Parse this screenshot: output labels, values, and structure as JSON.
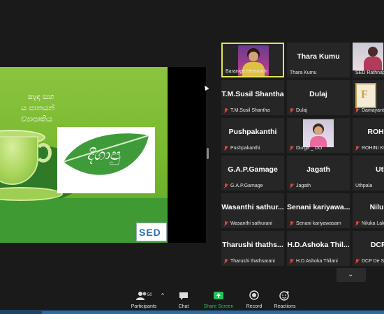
{
  "slide": {
    "lines": [
      "කැඳ සහ",
      "ය පානයන්",
      "ව්‍යාපෘතිය"
    ],
    "logo_text": "දීගාපු",
    "corner_logo": "SED"
  },
  "gallery": [
    {
      "name": "",
      "label": "Baranige Hemanthi",
      "type": "video",
      "active": true
    },
    {
      "name": "Thara Kumu",
      "label": "Thara Kumu",
      "type": "name"
    },
    {
      "name": "",
      "label": "SED Rathnapu",
      "type": "video"
    },
    {
      "name": "T.M.Susil Shantha",
      "label": "T.M.Susil Shantha",
      "type": "name",
      "muted": true
    },
    {
      "name": "Dulaj",
      "label": "Dulaj",
      "type": "name",
      "muted": true
    },
    {
      "name": "",
      "label": "Damayanti",
      "type": "video",
      "muted": true
    },
    {
      "name": "Pushpakanthi",
      "label": "Pushpakanthi",
      "type": "name",
      "muted": true
    },
    {
      "name": "",
      "label": "Durga _ DO",
      "type": "video",
      "muted": true
    },
    {
      "name": "ROHINI K",
      "label": "ROHINI KU",
      "type": "name",
      "muted": true
    },
    {
      "name": "G.A.P.Gamage",
      "label": "G.A.P.Gamage",
      "type": "name",
      "muted": true
    },
    {
      "name": "Jagath",
      "label": "Jagath",
      "type": "name",
      "muted": true
    },
    {
      "name": "Uthp",
      "label": "Uthpala",
      "type": "name"
    },
    {
      "name": "Wasanthi sathur...",
      "label": "Wasanthi sathurani",
      "type": "name",
      "muted": true
    },
    {
      "name": "Senani kariyawa...",
      "label": "Senani kariyawasam",
      "type": "name",
      "muted": true
    },
    {
      "name": "Niluka L",
      "label": "Niluka Lak",
      "type": "name",
      "muted": true
    },
    {
      "name": "Tharushi thaths...",
      "label": "Tharushi thathsarani",
      "type": "name",
      "muted": true
    },
    {
      "name": "H.D.Ashoka Thil...",
      "label": "H.D.Ashoka Thilani",
      "type": "name",
      "muted": true
    },
    {
      "name": "DCP De",
      "label": "DCP De Sc",
      "type": "name",
      "muted": true
    }
  ],
  "toolbar": {
    "participants_label": "Participants",
    "participants_count": "50",
    "chat_label": "Chat",
    "share_label": "Share Screen",
    "record_label": "Record",
    "reactions_label": "Reactions"
  },
  "colors": {
    "active_speaker": "#e3e35c",
    "share_screen": "#23c35a",
    "muted": "#e0443a"
  }
}
